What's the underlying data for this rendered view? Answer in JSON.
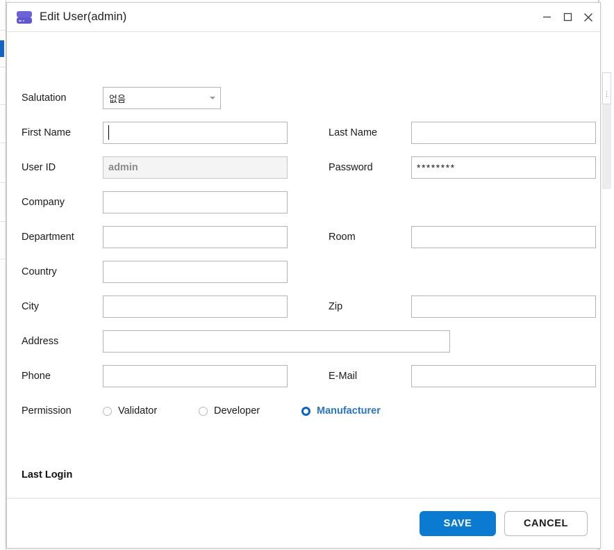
{
  "window": {
    "title": "Edit User(admin)",
    "icon": "server-icon",
    "controls": {
      "minimize": "minimize-icon",
      "maximize": "maximize-icon",
      "close": "close-icon"
    }
  },
  "form": {
    "salutation": {
      "label": "Salutation",
      "value": "없음",
      "placeholder": ""
    },
    "first_name": {
      "label": "First Name",
      "value": "",
      "placeholder": ""
    },
    "last_name": {
      "label": "Last Name",
      "value": "",
      "placeholder": ""
    },
    "user_id": {
      "label": "User ID",
      "value": "admin",
      "placeholder": ""
    },
    "password": {
      "label": "Password",
      "value": "********",
      "placeholder": ""
    },
    "company": {
      "label": "Company",
      "value": "",
      "placeholder": ""
    },
    "department": {
      "label": "Department",
      "value": "",
      "placeholder": ""
    },
    "room": {
      "label": "Room",
      "value": "",
      "placeholder": ""
    },
    "country": {
      "label": "Country",
      "value": "",
      "placeholder": ""
    },
    "city": {
      "label": "City",
      "value": "",
      "placeholder": ""
    },
    "zip": {
      "label": "Zip",
      "value": "",
      "placeholder": ""
    },
    "address": {
      "label": "Address",
      "value": "",
      "placeholder": ""
    },
    "phone": {
      "label": "Phone",
      "value": "",
      "placeholder": ""
    },
    "email": {
      "label": "E-Mail",
      "value": "",
      "placeholder": ""
    },
    "permission": {
      "label": "Permission",
      "options": [
        {
          "label": "Validator",
          "checked": false
        },
        {
          "label": "Developer",
          "checked": false
        },
        {
          "label": "Manufacturer",
          "checked": true
        }
      ]
    },
    "last_login": {
      "label": "Last Login",
      "value": ""
    }
  },
  "footer": {
    "save_label": "SAVE",
    "cancel_label": "CANCEL"
  },
  "colors": {
    "accent_blue": "#0b7ad1",
    "radio_blue": "#0b63c6",
    "checked_label_blue": "#2a74c9",
    "icon_purple": "#6c63d8",
    "disabled_bg": "#f4f4f4"
  }
}
